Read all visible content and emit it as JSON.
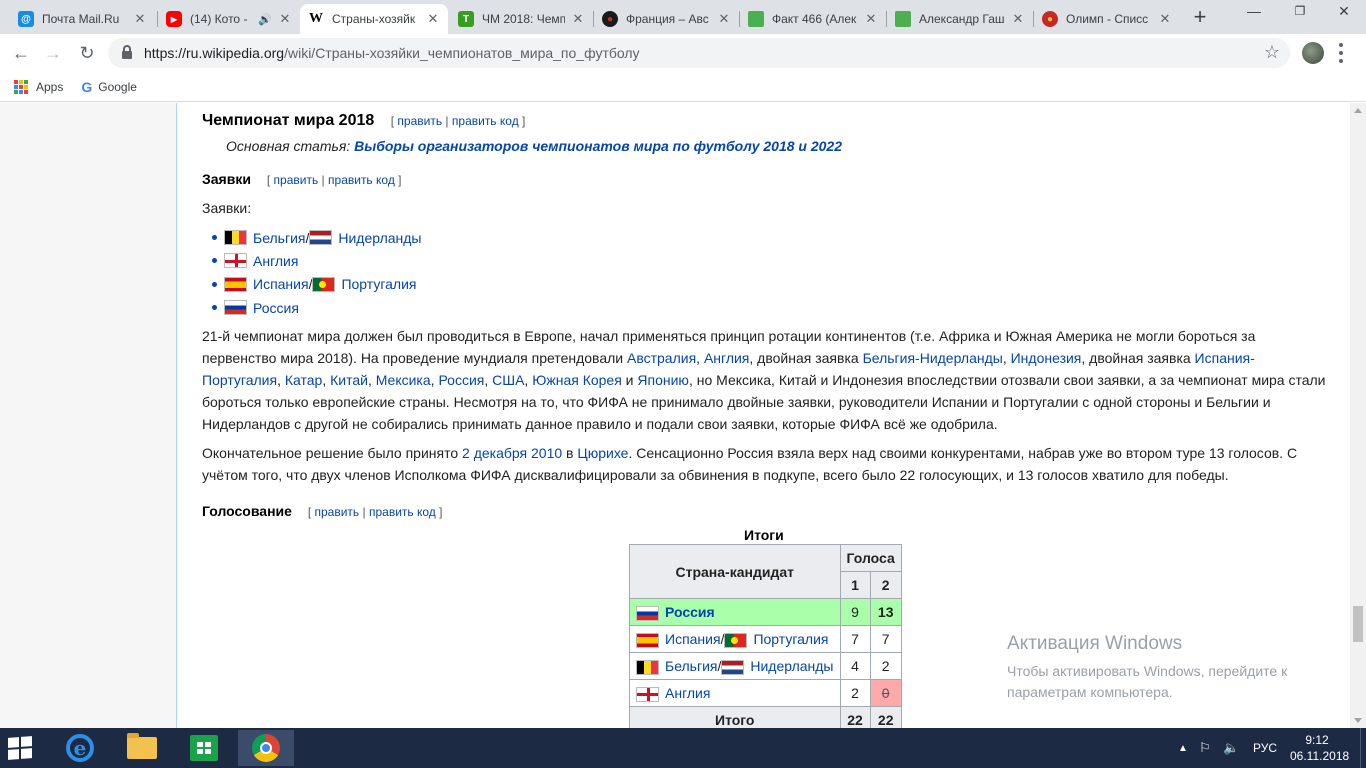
{
  "browser": {
    "tabs": [
      {
        "title": "Почта Mail.Ru",
        "icon": "mail-ru-icon",
        "color": "#168de2",
        "glyph": "@"
      },
      {
        "title": "(14) Кото -",
        "icon": "youtube-icon",
        "color": "#ff0000",
        "glyph": "▶",
        "extra": "🔊"
      },
      {
        "title": "Страны-хозяйк",
        "icon": "wikipedia-icon",
        "color": "#ffffff",
        "glyph": "W",
        "active": true
      },
      {
        "title": "ЧМ 2018: Чемп",
        "icon": "sport-icon",
        "color": "#3a9d23",
        "glyph": "T"
      },
      {
        "title": "Франция – Авс",
        "icon": "channel-icon",
        "color": "#d52b1e",
        "glyph": "●"
      },
      {
        "title": "Факт 466 (Алек",
        "icon": "page-icon",
        "color": "#4caf50",
        "glyph": ""
      },
      {
        "title": "Александр Гаш",
        "icon": "page-icon",
        "color": "#4caf50",
        "glyph": ""
      },
      {
        "title": "Олимп - Списс",
        "icon": "olimp-icon",
        "color": "#c62828",
        "glyph": "●"
      }
    ],
    "url_host": "https://ru.wikipedia.org",
    "url_path": "/wiki/Страны-хозяйки_чемпионатов_мира_по_футболу",
    "bookmarks": {
      "apps": "Apps",
      "google": "Google"
    }
  },
  "article": {
    "h_2018": "Чемпионат мира 2018",
    "edit_open": "[",
    "edit": "править",
    "edit_sep": "|",
    "edit_code": "править код",
    "edit_close": "]",
    "hatnote_prefix": "Основная статья: ",
    "hatnote_link": "Выборы организаторов чемпионатов мира по футболу 2018 и 2022",
    "h_bids": "Заявки",
    "bids_label": "Заявки:",
    "bids": {
      "be": "Бельгия",
      "nl": "Нидерланды",
      "en": "Англия",
      "es": "Испания",
      "pt": "Португалия",
      "ru": "Россия",
      "slash": "/"
    },
    "p1": {
      "t1": "21-й чемпионат мира должен был проводиться в Европе, начал применяться принцип ротации континентов (т.е. Африка и Южная Америка не могли бороться за первенство мира 2018). На проведение мундиаля претендовали ",
      "l_au": "Австралия",
      "c1": ", ",
      "l_en": "Англия",
      "t2": ", двойная заявка ",
      "l_benl": "Бельгия-Нидерланды",
      "c2": ", ",
      "l_id": "Индонезия",
      "t3": ", двойная заявка ",
      "l_espt": "Испания-Португалия",
      "c3": ", ",
      "l_qa": "Катар",
      "c4": ", ",
      "l_cn": "Китай",
      "c5": ", ",
      "l_mx": "Мексика",
      "c6": ", ",
      "l_ru": "Россия",
      "c7": ", ",
      "l_us": "США",
      "c8": ", ",
      "l_kr": "Южная Корея",
      "t4": " и ",
      "l_jp": "Японию",
      "t5": ", но Мексика, Китай и Индонезия впоследствии отозвали свои заявки, а за чемпионат мира стали бороться только европейские страны. Несмотря на то, что ФИФА не принимало двойные заявки, руководители Испании и Португалии с одной стороны и Бельгии и Нидерландов с другой не собирались принимать данное правило и подали свои заявки, которые ФИФА всё же одобрила."
    },
    "p2": {
      "t1": "Окончательное решение было принято ",
      "l_date": "2 декабря 2010",
      "t2": " в ",
      "l_city": "Цюрихе",
      "t3": ". Сенсационно Россия взяла верх над своими конкурентами, набрав уже во втором туре 13 голосов. С учётом того, что двух членов Исполкома ФИФА дисквалифицировали за обвинения в подкупе, всего было 22 голосующих, и 13 голосов хватило для победы."
    },
    "h_vote": "Голосование",
    "table": {
      "caption": "Итоги",
      "col_country": "Страна-кандидат",
      "col_votes": "Голоса",
      "round1": "1",
      "round2": "2",
      "rows": [
        {
          "name": "Россия",
          "r1": "9",
          "r2": "13"
        },
        {
          "name_a": "Испания",
          "slash": "/",
          "name_b": "Португалия",
          "r1": "7",
          "r2": "7"
        },
        {
          "name_a": "Бельгия",
          "slash": "/",
          "name_b": "Нидерланды",
          "r1": "4",
          "r2": "2"
        },
        {
          "name": "Англия",
          "r1": "2",
          "r2": "0"
        }
      ],
      "total_label": "Итого",
      "total_r1": "22",
      "total_r2": "22"
    }
  },
  "watermark": {
    "title": "Активация Windows",
    "line1": "Чтобы активировать Windows, перейдите к",
    "line2": "параметрам компьютера."
  },
  "taskbar": {
    "lang": "РУС",
    "time": "9:12",
    "date": "06.11.2018"
  },
  "colors": {
    "link": "#0645ad",
    "winner_row": "#aaffaa",
    "loser_cell": "#ffaaaa",
    "taskbar": "#1c2a44"
  }
}
